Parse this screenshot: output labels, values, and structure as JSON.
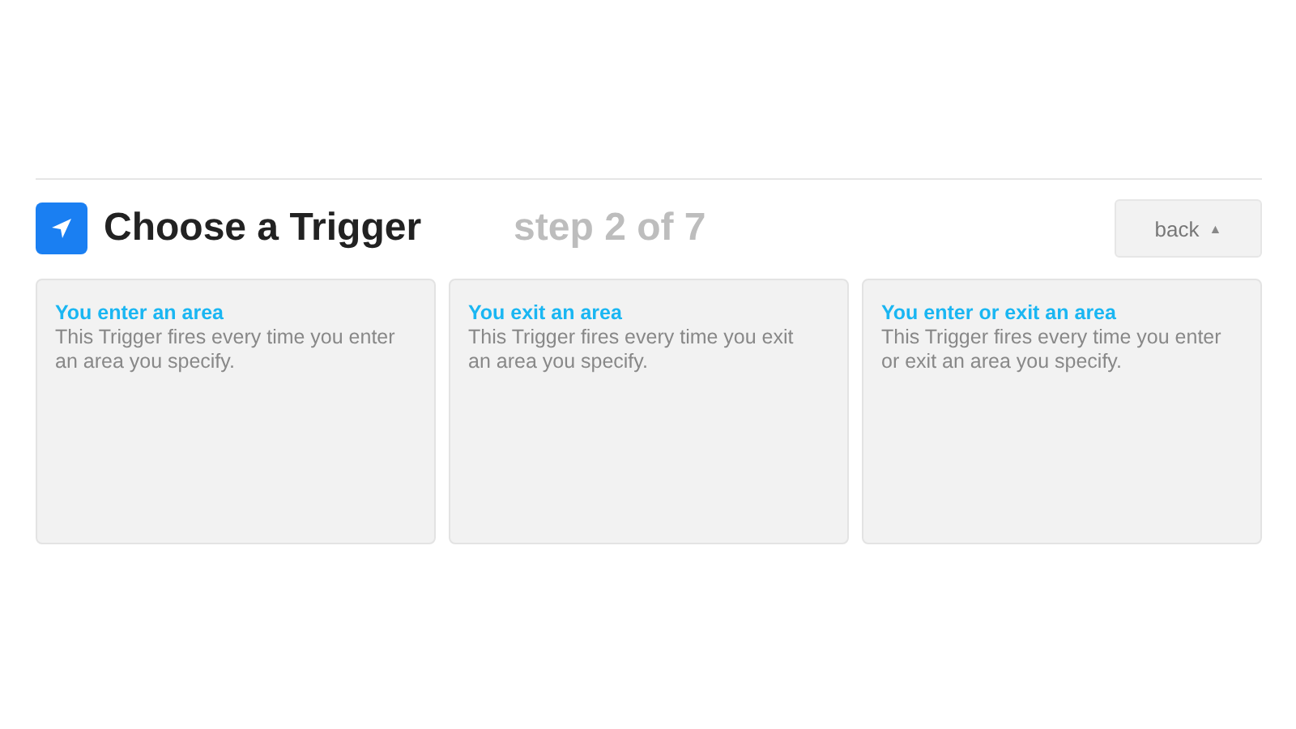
{
  "header": {
    "title": "Choose a Trigger",
    "step": "step 2 of 7",
    "back_button": {
      "label": "back",
      "caret": "▲"
    }
  },
  "triggers": [
    {
      "title": "You enter an area",
      "description": "This Trigger fires every time you enter an area you specify."
    },
    {
      "title": "You exit an area",
      "description": "This Trigger fires every time you exit an area you specify."
    },
    {
      "title": "You enter or exit an area",
      "description": "This Trigger fires every time you enter or exit an area you specify."
    }
  ]
}
